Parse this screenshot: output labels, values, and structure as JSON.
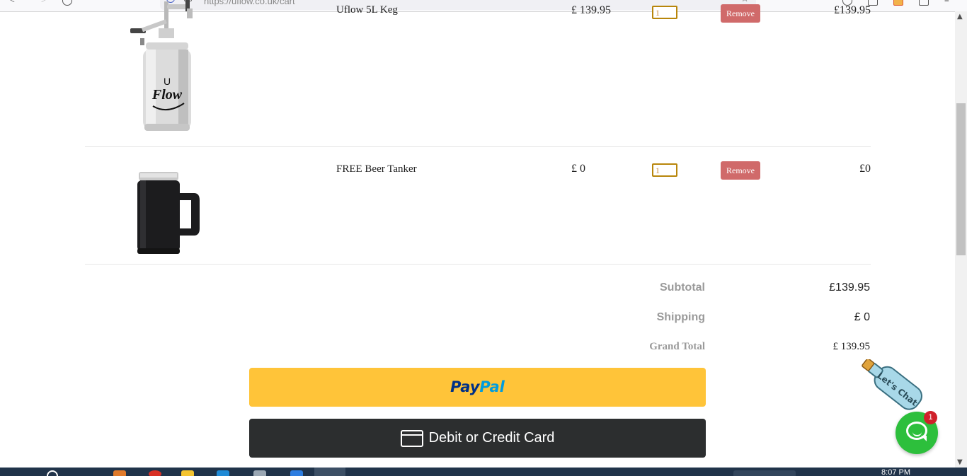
{
  "browser": {
    "url": "https://uflow.co.uk/cart"
  },
  "cart": {
    "items": [
      {
        "name": "Uflow 5L Keg",
        "price": "£ 139.95",
        "quantity": "1",
        "remove_label": "Remove",
        "total": "£139.95",
        "image_text": "U Flow"
      },
      {
        "name": "FREE Beer Tanker",
        "price": "£ 0",
        "quantity": "1",
        "remove_label": "Remove",
        "total": "£0"
      }
    ]
  },
  "totals": {
    "subtotal_label": "Subtotal",
    "subtotal_value": "£139.95",
    "shipping_label": "Shipping",
    "shipping_value": "£ 0",
    "grand_total_label": "Grand Total",
    "grand_total_value": "£ 139.95"
  },
  "payment": {
    "paypal_label_1": "Pay",
    "paypal_label_2": "Pal",
    "card_label": "Debit or Credit Card"
  },
  "chat": {
    "bottle_text": "Let's Chat",
    "badge_count": "1"
  },
  "taskbar": {
    "time": "8:07 PM"
  },
  "colors": {
    "paypal_yellow": "#ffc439",
    "card_dark": "#2c2e2f",
    "remove_red": "#d06a6a",
    "chat_green": "#2dbf3c",
    "badge_red": "#d0202a"
  }
}
